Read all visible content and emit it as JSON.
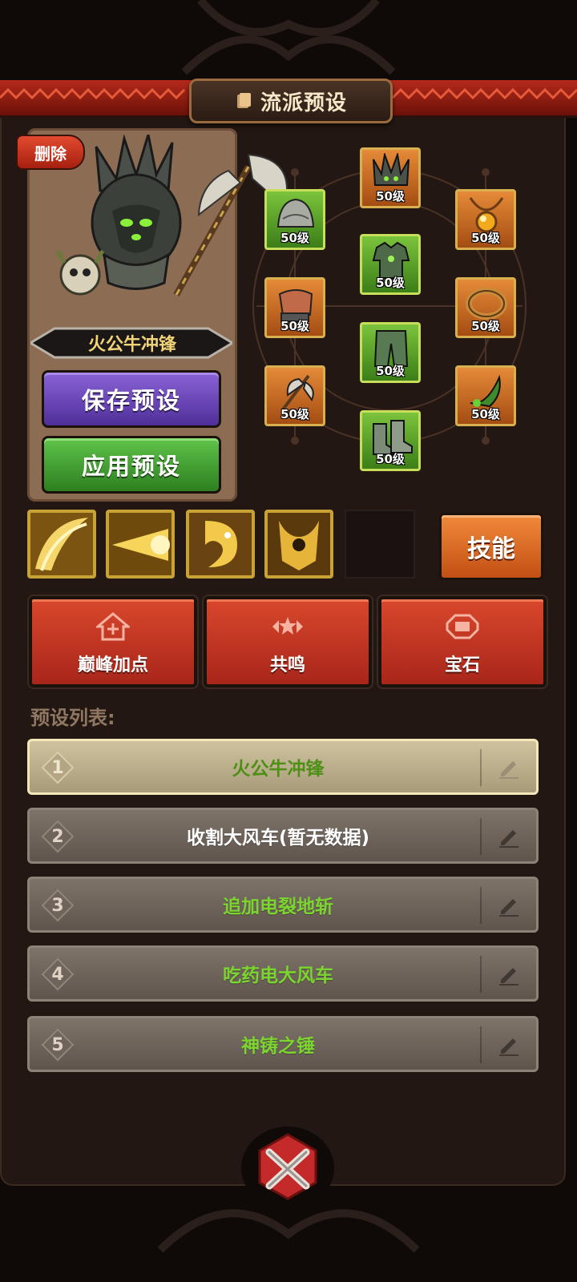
{
  "header": {
    "title": "流派预设"
  },
  "character": {
    "delete_label": "删除",
    "name": "火公牛冲锋",
    "save_label": "保存预设",
    "apply_label": "应用预设"
  },
  "equipment": [
    {
      "slot": "helmet",
      "level": "50级",
      "rarity": "orange"
    },
    {
      "slot": "shoulder",
      "level": "50级",
      "rarity": "green"
    },
    {
      "slot": "necklace",
      "level": "50级",
      "rarity": "orange"
    },
    {
      "slot": "chest",
      "level": "50级",
      "rarity": "green"
    },
    {
      "slot": "gloves",
      "level": "50级",
      "rarity": "orange"
    },
    {
      "slot": "ring",
      "level": "50级",
      "rarity": "orange"
    },
    {
      "slot": "pants",
      "level": "50级",
      "rarity": "green"
    },
    {
      "slot": "weapon",
      "level": "50级",
      "rarity": "orange"
    },
    {
      "slot": "charm",
      "level": "50级",
      "rarity": "orange"
    },
    {
      "slot": "boots",
      "level": "50级",
      "rarity": "green"
    }
  ],
  "skills": {
    "button_label": "技能",
    "icons": [
      "slash-skill-icon",
      "burst-skill-icon",
      "dragon-skill-icon",
      "rage-skill-icon"
    ]
  },
  "actions": [
    {
      "label": "巅峰加点",
      "icon": "peak-points-icon"
    },
    {
      "label": "共鸣",
      "icon": "resonance-icon"
    },
    {
      "label": "宝石",
      "icon": "gem-icon"
    }
  ],
  "preset_list": {
    "title": "预设列表:",
    "items": [
      {
        "number": "1",
        "name": "火公牛冲锋",
        "active": true
      },
      {
        "number": "2",
        "name": "收割大风车(暂无数据)",
        "active": false
      },
      {
        "number": "3",
        "name": "追加电裂地斩",
        "active": false
      },
      {
        "number": "4",
        "name": "吃药电大风车",
        "active": false
      },
      {
        "number": "5",
        "name": "神铸之锤",
        "active": false
      }
    ]
  },
  "colors": {
    "header_red": "#b52a1b",
    "purple_button": "#6a45b8",
    "green_button": "#3f9a2d",
    "orange_button": "#e0702a",
    "active_row": "#bfb08c",
    "green_text": "#7bd42f"
  }
}
